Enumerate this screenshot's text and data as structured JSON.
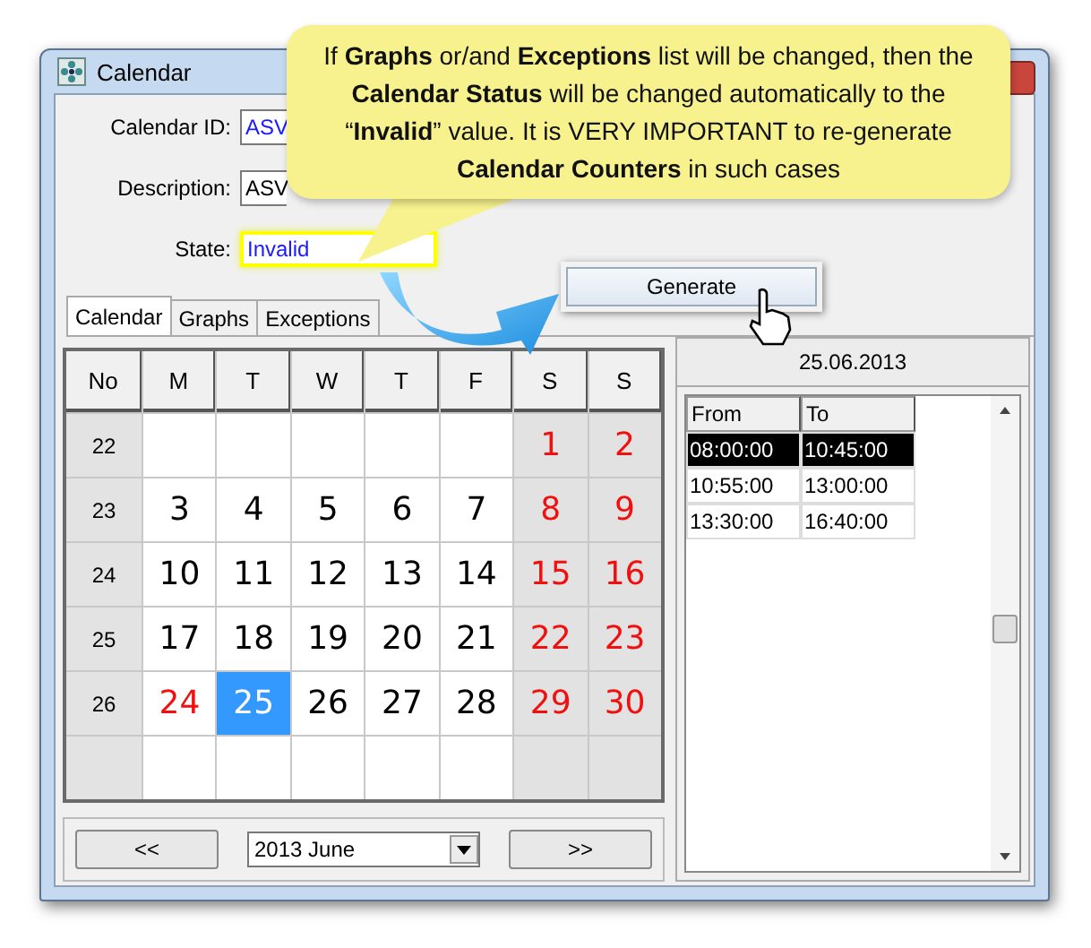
{
  "window": {
    "title": "Calendar"
  },
  "fields": [
    {
      "label": "Calendar ID:",
      "value": "ASV",
      "highlighted": false
    },
    {
      "label": "Description:",
      "value": "ASV",
      "highlighted": false
    },
    {
      "label": "State:",
      "value": "Invalid",
      "highlighted": true
    }
  ],
  "callout": {
    "text": "If **Graphs** or/and **Exceptions**  list will be changed, then the **Calendar Status** will be changed automatically to the “**Invalid**” value. It is VERY IMPORTANT to re-generate **Calendar Counters** in such cases"
  },
  "generate_button": {
    "label": "Generate"
  },
  "tabs": [
    {
      "label": "Calendar",
      "selected": true
    },
    {
      "label": "Graphs",
      "selected": false
    },
    {
      "label": "Exceptions",
      "selected": false
    }
  ],
  "calendar": {
    "columns": [
      {
        "label": "No",
        "weekend": false
      },
      {
        "label": "M",
        "weekend": false
      },
      {
        "label": "T",
        "weekend": false
      },
      {
        "label": "W",
        "weekend": false
      },
      {
        "label": "T",
        "weekend": false
      },
      {
        "label": "F",
        "weekend": false
      },
      {
        "label": "S",
        "weekend": true
      },
      {
        "label": "S",
        "weekend": true
      }
    ],
    "weeks": [
      {
        "number": "22",
        "days": [
          {
            "day": "1",
            "holiday": true,
            "selected": false
          },
          {
            "day": "2",
            "holiday": true,
            "selected": false
          }
        ]
      },
      {
        "number": "23",
        "days": [
          {
            "day": "3",
            "holiday": false,
            "selected": false
          },
          {
            "day": "4",
            "holiday": false,
            "selected": false
          },
          {
            "day": "5",
            "holiday": false,
            "selected": false
          },
          {
            "day": "6",
            "holiday": false,
            "selected": false
          },
          {
            "day": "7",
            "holiday": false,
            "selected": false
          },
          {
            "day": "8",
            "holiday": true,
            "selected": false
          },
          {
            "day": "9",
            "holiday": true,
            "selected": false
          }
        ]
      },
      {
        "number": "24",
        "days": [
          {
            "day": "10",
            "holiday": false,
            "selected": false
          },
          {
            "day": "11",
            "holiday": false,
            "selected": false
          },
          {
            "day": "12",
            "holiday": false,
            "selected": false
          },
          {
            "day": "13",
            "holiday": false,
            "selected": false
          },
          {
            "day": "14",
            "holiday": false,
            "selected": false
          },
          {
            "day": "15",
            "holiday": true,
            "selected": false
          },
          {
            "day": "16",
            "holiday": true,
            "selected": false
          }
        ]
      },
      {
        "number": "25",
        "days": [
          {
            "day": "17",
            "holiday": false,
            "selected": false
          },
          {
            "day": "18",
            "holiday": false,
            "selected": false
          },
          {
            "day": "19",
            "holiday": false,
            "selected": false
          },
          {
            "day": "20",
            "holiday": false,
            "selected": false
          },
          {
            "day": "21",
            "holiday": false,
            "selected": false
          },
          {
            "day": "22",
            "holiday": true,
            "selected": false
          },
          {
            "day": "23",
            "holiday": true,
            "selected": false
          }
        ]
      },
      {
        "number": "26",
        "days": [
          {
            "day": "24",
            "holiday": true,
            "selected": false
          },
          {
            "day": "25",
            "holiday": false,
            "selected": true
          },
          {
            "day": "26",
            "holiday": false,
            "selected": false
          },
          {
            "day": "27",
            "holiday": false,
            "selected": false
          },
          {
            "day": "28",
            "holiday": false,
            "selected": false
          },
          {
            "day": "29",
            "holiday": true,
            "selected": false
          },
          {
            "day": "30",
            "holiday": true,
            "selected": false
          }
        ]
      }
    ],
    "prev_button": "<<",
    "month": "2013 June",
    "next_button": ">>"
  },
  "schedule": {
    "date": "25.06.2013",
    "columns": [
      "From",
      "To"
    ],
    "rows": [
      {
        "from": "08:00:00",
        "to": "10:45:00",
        "selected": true
      },
      {
        "from": "10:55:00",
        "to": "13:00:00",
        "selected": false
      },
      {
        "from": "13:30:00",
        "to": "16:40:00",
        "selected": false
      }
    ]
  }
}
